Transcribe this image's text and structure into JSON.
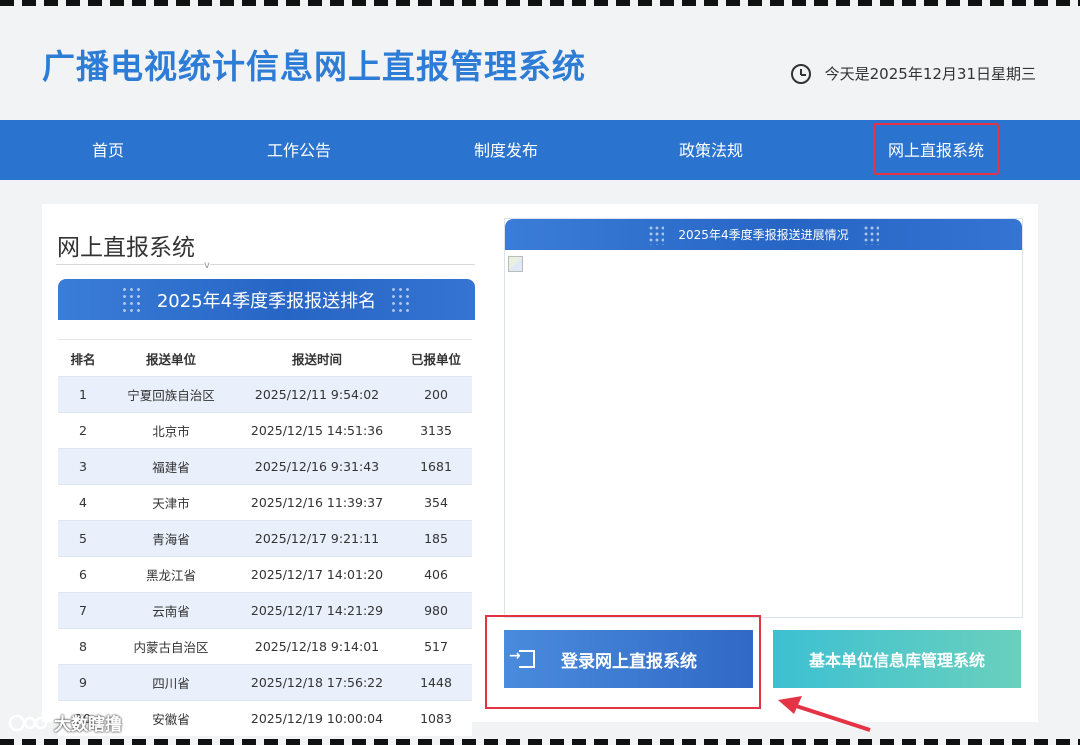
{
  "header": {
    "site_title": "广播电视统计信息网上直报管理系统",
    "date_text": "今天是2025年12月31日星期三",
    "clock_icon": "clock-icon"
  },
  "nav": {
    "items": [
      "首页",
      "工作公告",
      "制度发布",
      "政策法规",
      "网上直报系统"
    ],
    "active_index": 4
  },
  "main": {
    "section_title": "网上直报系统",
    "ranking": {
      "title": "2025年4季度季报报送排名",
      "columns": [
        "排名",
        "报送单位",
        "报送时间",
        "已报单位"
      ],
      "rows": [
        [
          "1",
          "宁夏回族自治区",
          "2025/12/11 9:54:02",
          "200"
        ],
        [
          "2",
          "北京市",
          "2025/12/15 14:51:36",
          "3135"
        ],
        [
          "3",
          "福建省",
          "2025/12/16 9:31:43",
          "1681"
        ],
        [
          "4",
          "天津市",
          "2025/12/16 11:39:37",
          "354"
        ],
        [
          "5",
          "青海省",
          "2025/12/17 9:21:11",
          "185"
        ],
        [
          "6",
          "黑龙江省",
          "2025/12/17 14:01:20",
          "406"
        ],
        [
          "7",
          "云南省",
          "2025/12/17 14:21:29",
          "980"
        ],
        [
          "8",
          "内蒙古自治区",
          "2025/12/18 9:14:01",
          "517"
        ],
        [
          "9",
          "四川省",
          "2025/12/18 17:56:22",
          "1448"
        ],
        [
          "10",
          "安徽省",
          "2025/12/19 10:00:04",
          "1083"
        ]
      ]
    },
    "progress": {
      "title": "2025年4季度季报报送进展情况"
    },
    "buttons": {
      "login": "登录网上直报系统",
      "basic_db": "基本单位信息库管理系统",
      "login_icon": "login-icon"
    }
  },
  "watermark": {
    "logo_text": "大数瞎撸"
  },
  "colors": {
    "brand_blue": "#2a74cf",
    "title_blue": "#2d7cd6",
    "highlight_red": "#e53346",
    "teal": "#3dc0d2"
  }
}
